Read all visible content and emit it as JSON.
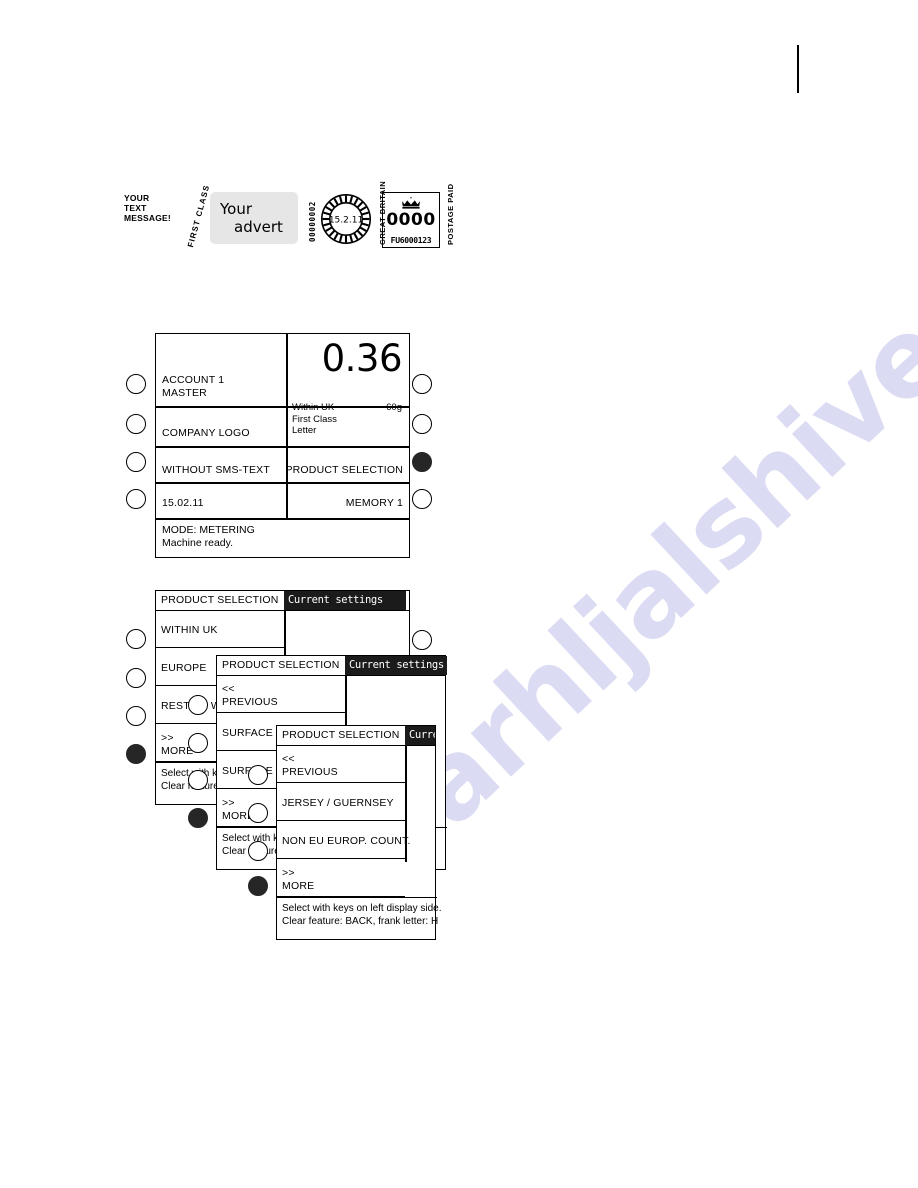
{
  "imprint": {
    "slogan_lines": [
      "YOUR",
      "TEXT",
      "MESSAGE!"
    ],
    "class_label": "FIRST CLASS",
    "advert_line1": "Your",
    "advert_line2": "advert",
    "meter_serial": "00000002",
    "die_ring_text": "DEMONSTRATION",
    "die_date": "15.2.11",
    "country_label": "GREAT BRITAIN",
    "postage_label": "POSTAGE PAID",
    "value_digits": "0000",
    "value_code": "FU6000123",
    "crown_icon": "crown-icon"
  },
  "display_main": {
    "account_line1": "ACCOUNT 1",
    "account_line2": "MASTER",
    "company_logo": "COMPANY LOGO",
    "sms_text": "WITHOUT SMS-TEXT",
    "date": "15.02.11",
    "amount": "0.36",
    "destination_line1": "Within UK",
    "destination_line2": "First Class",
    "destination_line3": "Letter",
    "weight": "60g",
    "product_selection": "PRODUCT SELECTION",
    "memory": "MEMORY 1",
    "mode_line1": "MODE: METERING",
    "mode_line2": "Machine ready.",
    "left_keys": [
      {
        "name": "key-left-1",
        "state": "open"
      },
      {
        "name": "key-left-2",
        "state": "open"
      },
      {
        "name": "key-left-3",
        "state": "open"
      },
      {
        "name": "key-left-4",
        "state": "open"
      }
    ],
    "right_keys": [
      {
        "name": "key-right-1",
        "state": "open"
      },
      {
        "name": "key-right-2",
        "state": "open"
      },
      {
        "name": "key-right-3",
        "state": "filled"
      },
      {
        "name": "key-right-4",
        "state": "open"
      }
    ]
  },
  "panel1": {
    "title": "PRODUCT SELECTION",
    "current_settings": "Current settings",
    "items": [
      {
        "label": "WITHIN UK"
      },
      {
        "label": "EUROPE"
      },
      {
        "label": "REST OF WORLD"
      },
      {
        "label_top": ">>",
        "label_bottom": "MORE"
      }
    ],
    "footer_line1": "Select with keys on left display side.",
    "footer_line2": "Clear feature: BACK,  frank letter: H",
    "left_keys": [
      {
        "name": "key-p1-1",
        "state": "open"
      },
      {
        "name": "key-p1-2",
        "state": "open"
      },
      {
        "name": "key-p1-3",
        "state": "open"
      },
      {
        "name": "key-p1-4",
        "state": "filled"
      },
      {
        "name": "key-p1-5",
        "state": "open"
      }
    ],
    "right_keys": [
      {
        "name": "key-p1-right-1",
        "state": "open"
      }
    ]
  },
  "panel2": {
    "title": "PRODUCT SELECTION",
    "current_settings": "Current settings",
    "items": [
      {
        "label_top": "<<",
        "label_bottom": "PREVIOUS"
      },
      {
        "label": "SURFACE"
      },
      {
        "label": "SURFACE"
      },
      {
        "label_top": ">>",
        "label_bottom": "MORE"
      }
    ],
    "footer_line1": "Select with keys on left display side.",
    "footer_line2": "Clear feature: BACK,  frank letter: H",
    "left_keys": [
      {
        "name": "key-p2-1",
        "state": "open"
      },
      {
        "name": "key-p2-2",
        "state": "open"
      },
      {
        "name": "key-p2-3",
        "state": "open"
      },
      {
        "name": "key-p2-4",
        "state": "open"
      },
      {
        "name": "key-p2-5",
        "state": "filled"
      }
    ]
  },
  "panel3": {
    "title": "PRODUCT SELECTION",
    "current_settings": "Current settings",
    "items": [
      {
        "label_top": "<<",
        "label_bottom": "PREVIOUS"
      },
      {
        "label": "JERSEY / GUERNSEY"
      },
      {
        "label": "NON EU EUROP. COUNT."
      },
      {
        "label_top": ">>",
        "label_bottom": "MORE"
      }
    ],
    "footer_line1": "Select with keys on left display side.",
    "footer_line2": "Clear feature: BACK,  frank letter: H",
    "left_keys": [
      {
        "name": "key-p3-1",
        "state": "open"
      },
      {
        "name": "key-p3-2",
        "state": "open"
      },
      {
        "name": "key-p3-3",
        "state": "open"
      },
      {
        "name": "key-p3-4",
        "state": "filled"
      }
    ]
  },
  "watermark": {
    "text": "parhljalshive.com"
  },
  "colors": {
    "ink": "#000000",
    "inverse_bg": "#1b1b1b",
    "advert_bg": "#e6e6e6",
    "key_filled": "#262626",
    "watermark": "#d8d8f2"
  }
}
